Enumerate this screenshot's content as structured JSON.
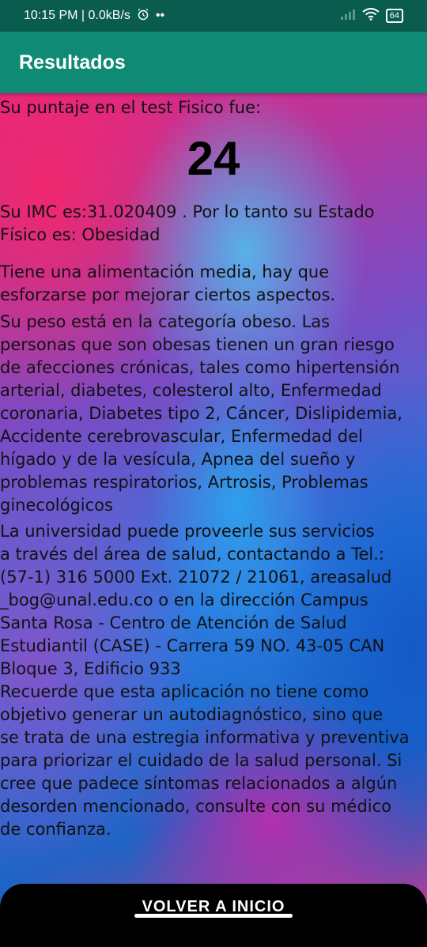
{
  "status_bar": {
    "time_speed": "10:15 PM | 0.0kB/s",
    "alarm_icon": "alarm-clock-icon",
    "dots": "••",
    "battery": "64"
  },
  "app_bar": {
    "title": "Resultados"
  },
  "results": {
    "score_label": "Su puntaje en el test Fisico fue:",
    "score": "24",
    "imc_line1": "Su IMC es:31.020409 . Por lo tanto su Estado",
    "imc_line2": "Físico  es: Obesidad",
    "diet_line1": "Tiene una alimentación media, hay que",
    "diet_line2": "esforzarse por mejorar ciertos aspectos.",
    "weight_lines": [
      "Su peso está en la categoría obeso. Las",
      "personas que son obesas tienen un gran riesgo",
      "de afecciones crónicas, tales como hipertensión",
      "arterial, diabetes, colesterol alto, Enfermedad",
      "coronaria, Diabetes tipo 2, Cáncer, Dislipidemia,",
      "Accidente cerebrovascular, Enfermedad del",
      "hígado y de la vesícula, Apnea del sueño y",
      "problemas respiratorios, Artrosis, Problemas",
      "ginecológicos"
    ],
    "contact_lines": [
      "La universidad puede proveerle sus servicios",
      "a través del área de salud, contactando a Tel.:",
      "(57-1) 316 5000 Ext. 21072 / 21061, areasalud",
      "_bog@unal.edu.co o en la dirección Campus",
      "Santa Rosa - Centro de Atención de Salud",
      "Estudiantil (CASE) - Carrera 59 NO. 43-05 CAN",
      "Bloque 3, Edificio 933"
    ],
    "disclaimer_lines": [
      "Recuerde que esta aplicación no tiene como",
      "objetivo generar un autodiagnóstico, sino que",
      "se trata de una estregia informativa y preventiva",
      "para priorizar el cuidado de la salud personal. Si",
      "cree que padece síntomas relacionados a algún",
      "desorden mencionado, consulte con su médico",
      "de confianza."
    ]
  },
  "bottom_button": {
    "label": "VOLVER A INICIO"
  }
}
